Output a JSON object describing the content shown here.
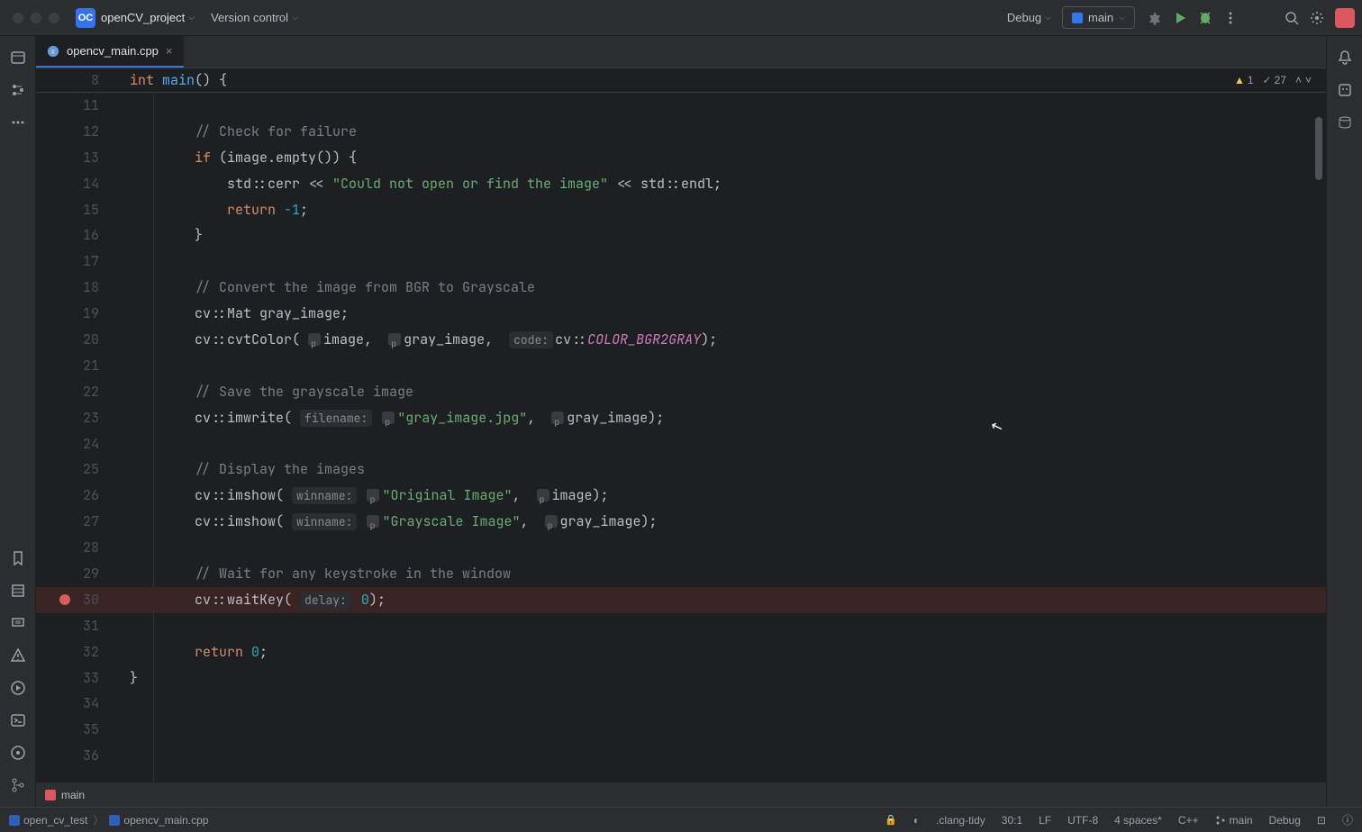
{
  "titlebar": {
    "project_badge": "OC",
    "project_name": "openCV_project",
    "vcs_label": "Version control",
    "run_config": "Debug",
    "run_target": "main"
  },
  "tab": {
    "filename": "opencv_main.cpp"
  },
  "sticky": {
    "line_no": "8",
    "code_kw": "int",
    "code_fn": "main",
    "code_rest": "() {"
  },
  "inspections": {
    "warnings": "1",
    "weak": "27"
  },
  "lines": [
    {
      "n": "11",
      "type": "blank"
    },
    {
      "n": "12",
      "type": "comment",
      "text": "// Check for failure",
      "indent": 2
    },
    {
      "n": "13",
      "type": "if",
      "indent": 2,
      "kw": "if",
      "rest": " (image.empty()) {"
    },
    {
      "n": "14",
      "type": "stmt",
      "indent": 3,
      "pre": "std::cerr << ",
      "str": "\"Could not open or find the image\"",
      "post": " << std::endl;"
    },
    {
      "n": "15",
      "type": "ret",
      "indent": 3,
      "kw": "return ",
      "num": "-1",
      "post": ";"
    },
    {
      "n": "16",
      "type": "plain",
      "indent": 2,
      "text": "}"
    },
    {
      "n": "17",
      "type": "blank"
    },
    {
      "n": "18",
      "type": "comment",
      "indent": 2,
      "text": "// Convert the image from BGR to Grayscale"
    },
    {
      "n": "19",
      "type": "decl",
      "indent": 2,
      "pre": "cv::Mat ",
      "id": "gray_image",
      "post": ";"
    },
    {
      "n": "20",
      "type": "cvtcolor",
      "indent": 2
    },
    {
      "n": "21",
      "type": "blank"
    },
    {
      "n": "22",
      "type": "comment",
      "indent": 2,
      "text": "// Save the grayscale image"
    },
    {
      "n": "23",
      "type": "imwrite",
      "indent": 2
    },
    {
      "n": "24",
      "type": "blank"
    },
    {
      "n": "25",
      "type": "comment",
      "indent": 2,
      "text": "// Display the images"
    },
    {
      "n": "26",
      "type": "imshow1",
      "indent": 2
    },
    {
      "n": "27",
      "type": "imshow2",
      "indent": 2
    },
    {
      "n": "28",
      "type": "blank"
    },
    {
      "n": "29",
      "type": "comment",
      "indent": 2,
      "text": "// Wait for any keystroke in the window"
    },
    {
      "n": "30",
      "type": "waitkey",
      "indent": 2,
      "bp": true
    },
    {
      "n": "31",
      "type": "blank"
    },
    {
      "n": "32",
      "type": "ret",
      "indent": 2,
      "kw": "return ",
      "num": "0",
      "post": ";"
    },
    {
      "n": "33",
      "type": "plain",
      "indent": 0,
      "text": "}"
    },
    {
      "n": "34",
      "type": "blank"
    },
    {
      "n": "35",
      "type": "blank"
    },
    {
      "n": "36",
      "type": "blank"
    }
  ],
  "tokens": {
    "cvtcolor": {
      "call": "cv::cvtColor(",
      "a1": "image",
      "a2": "gray_image",
      "hint": "code:",
      "a3ns": "cv::",
      "a3": "COLOR_BGR2GRAY",
      "end": ");"
    },
    "imwrite": {
      "call": "cv::imwrite(",
      "hint": "filename:",
      "str": "\"gray_image.jpg\"",
      "a2": "gray_image",
      "end": ");"
    },
    "imshow1": {
      "call": "cv::imshow(",
      "hint": "winname:",
      "str": "\"Original Image\"",
      "a2": "image",
      "end": ");"
    },
    "imshow2": {
      "call": "cv::imshow(",
      "hint": "winname:",
      "str": "\"Grayscale Image\"",
      "a2": "gray_image",
      "end": ");"
    },
    "waitkey": {
      "call": "cv::waitKey(",
      "hint": "delay:",
      "num": "0",
      "end": ");"
    }
  },
  "bottom_panel": {
    "branch": "main"
  },
  "statusbar": {
    "crumb1": "open_cv_test",
    "crumb2": "opencv_main.cpp",
    "clang": ".clang-tidy",
    "pos": "30:1",
    "eol": "LF",
    "enc": "UTF-8",
    "indent": "4 spaces*",
    "lang": "C++",
    "branch": "main",
    "config": "Debug"
  }
}
